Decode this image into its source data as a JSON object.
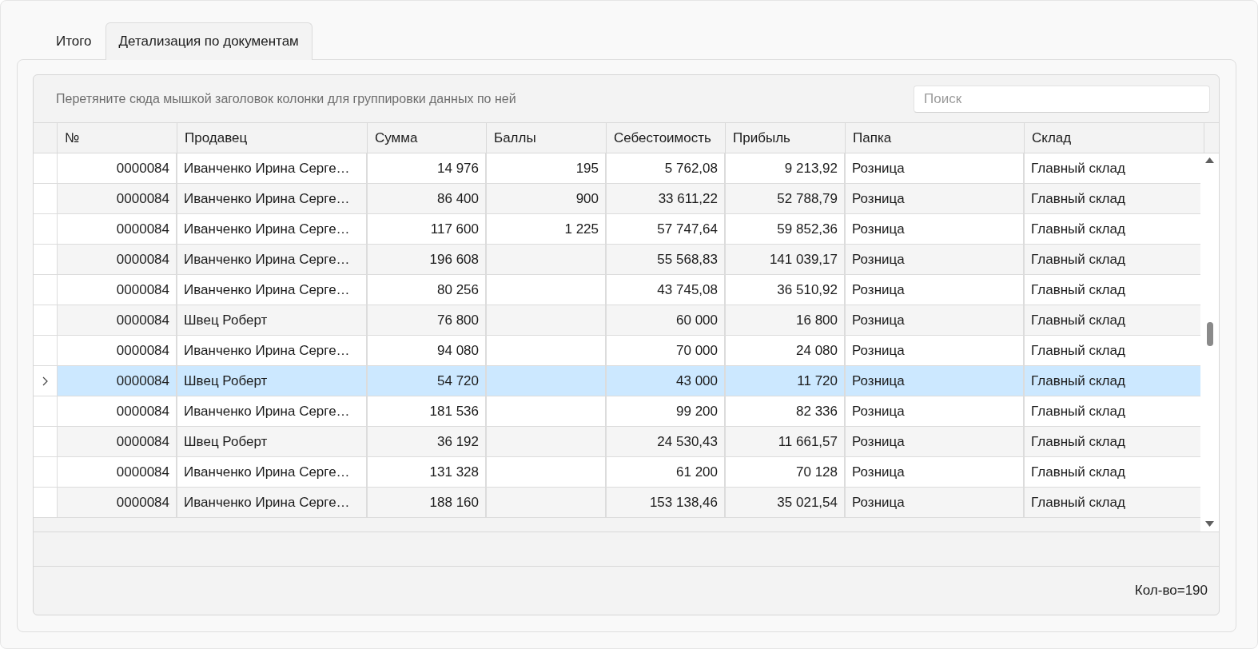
{
  "tabs": [
    {
      "label": "Итого",
      "selected": false
    },
    {
      "label": "Детализация по документам",
      "selected": true
    }
  ],
  "group_panel": {
    "hint": "Перетяните сюда мышкой заголовок колонки для группировки данных по ней"
  },
  "search": {
    "placeholder": "Поиск"
  },
  "table": {
    "columns": [
      "№",
      "Продавец",
      "Сумма",
      "Баллы",
      "Себестоимость",
      "Прибыль",
      "Папка",
      "Склад"
    ],
    "rows": [
      {
        "selected": false,
        "cells": [
          "0000084",
          "Иванченко Ирина Серге…",
          "14 976",
          "195",
          "5 762,08",
          "9 213,92",
          "Розница",
          "Главный склад"
        ]
      },
      {
        "selected": false,
        "cells": [
          "0000084",
          "Иванченко Ирина Серге…",
          "86 400",
          "900",
          "33 611,22",
          "52 788,79",
          "Розница",
          "Главный склад"
        ]
      },
      {
        "selected": false,
        "cells": [
          "0000084",
          "Иванченко Ирина Серге…",
          "117 600",
          "1 225",
          "57 747,64",
          "59 852,36",
          "Розница",
          "Главный склад"
        ]
      },
      {
        "selected": false,
        "cells": [
          "0000084",
          "Иванченко Ирина Серге…",
          "196 608",
          "",
          "55 568,83",
          "141 039,17",
          "Розница",
          "Главный склад"
        ]
      },
      {
        "selected": false,
        "cells": [
          "0000084",
          "Иванченко Ирина Серге…",
          "80 256",
          "",
          "43 745,08",
          "36 510,92",
          "Розница",
          "Главный склад"
        ]
      },
      {
        "selected": false,
        "cells": [
          "0000084",
          "Швец Роберт",
          "76 800",
          "",
          "60 000",
          "16 800",
          "Розница",
          "Главный склад"
        ]
      },
      {
        "selected": false,
        "cells": [
          "0000084",
          "Иванченко Ирина Серге…",
          "94 080",
          "",
          "70 000",
          "24 080",
          "Розница",
          "Главный склад"
        ]
      },
      {
        "selected": true,
        "cells": [
          "0000084",
          "Швец Роберт",
          "54 720",
          "",
          "43 000",
          "11 720",
          "Розница",
          "Главный склад"
        ]
      },
      {
        "selected": false,
        "cells": [
          "0000084",
          "Иванченко Ирина Серге…",
          "181 536",
          "",
          "99 200",
          "82 336",
          "Розница",
          "Главный склад"
        ]
      },
      {
        "selected": false,
        "cells": [
          "0000084",
          "Швец Роберт",
          "36 192",
          "",
          "24 530,43",
          "11 661,57",
          "Розница",
          "Главный склад"
        ]
      },
      {
        "selected": false,
        "cells": [
          "0000084",
          "Иванченко Ирина Серге…",
          "131 328",
          "",
          "61 200",
          "70 128",
          "Розница",
          "Главный склад"
        ]
      },
      {
        "selected": false,
        "cells": [
          "0000084",
          "Иванченко Ирина Серге…",
          "188 160",
          "",
          "153 138,46",
          "35 021,54",
          "Розница",
          "Главный склад"
        ]
      }
    ]
  },
  "footer": {
    "count": "Кол-во=190"
  }
}
